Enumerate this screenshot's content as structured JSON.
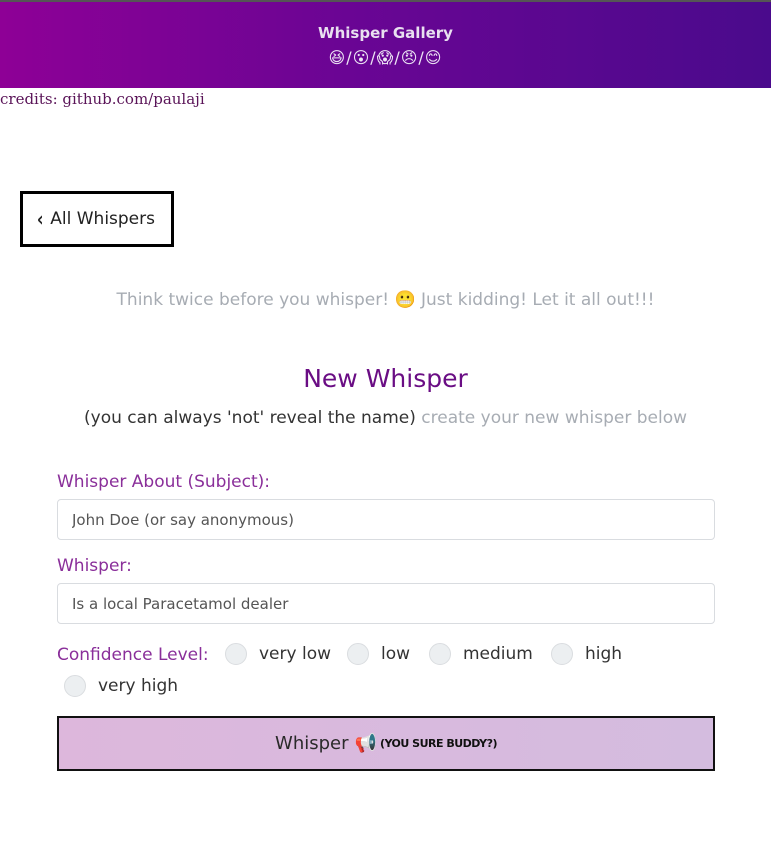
{
  "header": {
    "title": "Whisper Gallery",
    "faces": "😆/😮/😱/😠/😊"
  },
  "credits": "credits: github.com/paulaji",
  "back_button": {
    "chevron": "‹",
    "label": "All Whispers"
  },
  "tagline": {
    "text_before": "Think twice before you whisper! ",
    "emoji": "😬",
    "text_after": " Just kidding! Let it all out!!!"
  },
  "form": {
    "title": "New Whisper",
    "subtitle_main": "(you can always 'not' reveal the name)",
    "subtitle_muted": " create your new whisper below",
    "subject_label": "Whisper About (Subject):",
    "subject_placeholder": "John Doe (or say anonymous)",
    "whisper_label": "Whisper:",
    "whisper_placeholder": "Is a local Paracetamol dealer",
    "confidence_label": "Confidence Level:",
    "confidence_options": [
      "very low",
      "low",
      "medium",
      "high",
      "very high"
    ],
    "submit": {
      "label": "Whisper",
      "icon": "megaphone-icon",
      "icon_glyph": "📢",
      "note": "(YOU SURE BUDDY?)"
    }
  },
  "colors": {
    "header_gradient_start": "#8e0096",
    "header_gradient_end": "#4a0a8c",
    "accent_purple": "#6a0d84",
    "label_purple": "#8a2f9a",
    "muted_text": "#a7acb3"
  }
}
